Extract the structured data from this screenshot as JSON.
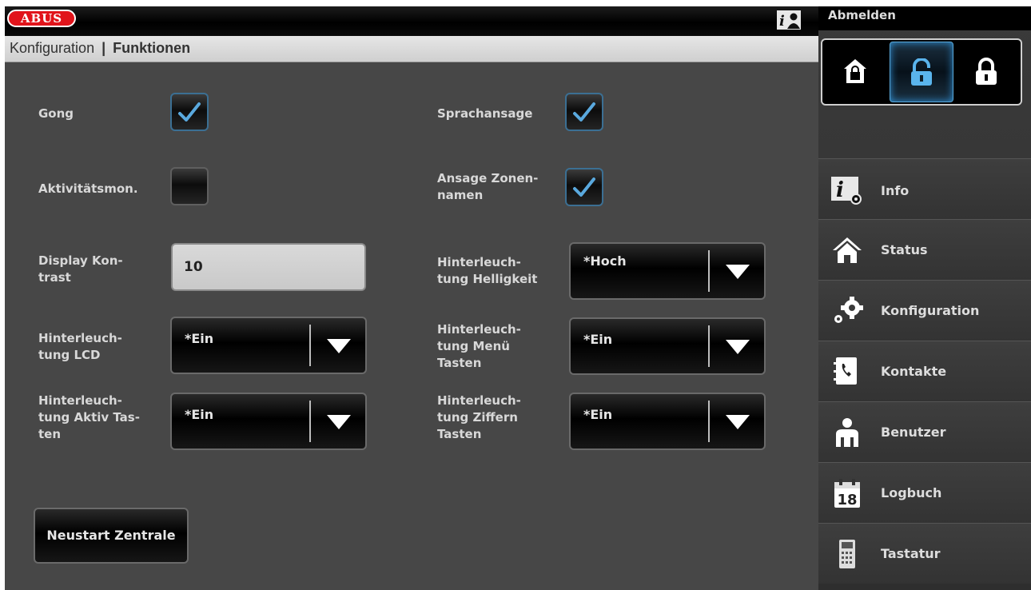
{
  "header": {
    "logo_text": "ABUS",
    "breadcrumb_parent": "Konfiguration",
    "breadcrumb_separator": "|",
    "breadcrumb_current": "Funktionen",
    "help_icon": "info-user-icon"
  },
  "sidebar": {
    "logout_label": "Abmelden",
    "arm_states": [
      {
        "icon": "home-lock-icon",
        "active": false
      },
      {
        "icon": "unlock-icon",
        "active": true
      },
      {
        "icon": "lock-icon",
        "active": false
      }
    ],
    "items": [
      {
        "label": "Info",
        "icon": "info-gear-icon"
      },
      {
        "label": "Status",
        "icon": "house-icon"
      },
      {
        "label": "Konfiguration",
        "icon": "gears-icon"
      },
      {
        "label": "Kontakte",
        "icon": "phonebook-icon"
      },
      {
        "label": "Benutzer",
        "icon": "user-icon"
      },
      {
        "label": "Logbuch",
        "icon": "calendar-icon"
      },
      {
        "label": "Tastatur",
        "icon": "keypad-icon"
      }
    ],
    "calendar_day": "18"
  },
  "settings": {
    "gong": {
      "label": "Gong",
      "checked": true
    },
    "sprachansage": {
      "label": "Sprachansage",
      "checked": true
    },
    "aktivitaet": {
      "label": "Aktivitätsmon.",
      "checked": false
    },
    "ansage_zonen": {
      "label_line1": "Ansage Zonen-",
      "label_line2": "namen",
      "checked": true
    },
    "display_kontrast": {
      "label_line1": "Display Kon-",
      "label_line2": "trast",
      "value": "10"
    },
    "hl_helligkeit": {
      "label_line1": "Hinterleuch-",
      "label_line2": "tung Helligkeit",
      "value": "*Hoch"
    },
    "hl_lcd": {
      "label_line1": "Hinterleuch-",
      "label_line2": "tung LCD",
      "value": "*Ein"
    },
    "hl_menu": {
      "label_line1": "Hinterleuch-",
      "label_line2": "tung Menü",
      "label_line3": "Tasten",
      "value": "*Ein"
    },
    "hl_aktiv": {
      "label_line1": "Hinterleuch-",
      "label_line2": "tung Aktiv Tas-",
      "label_line3": "ten",
      "value": "*Ein"
    },
    "hl_ziffern": {
      "label_line1": "Hinterleuch-",
      "label_line2": "tung Ziffern",
      "label_line3": "Tasten",
      "value": "*Ein"
    }
  },
  "actions": {
    "restart_label": "Neustart Zentrale"
  },
  "colors": {
    "accent": "#3b8fd0",
    "logo_red": "#e1141b",
    "background": "#474747"
  }
}
